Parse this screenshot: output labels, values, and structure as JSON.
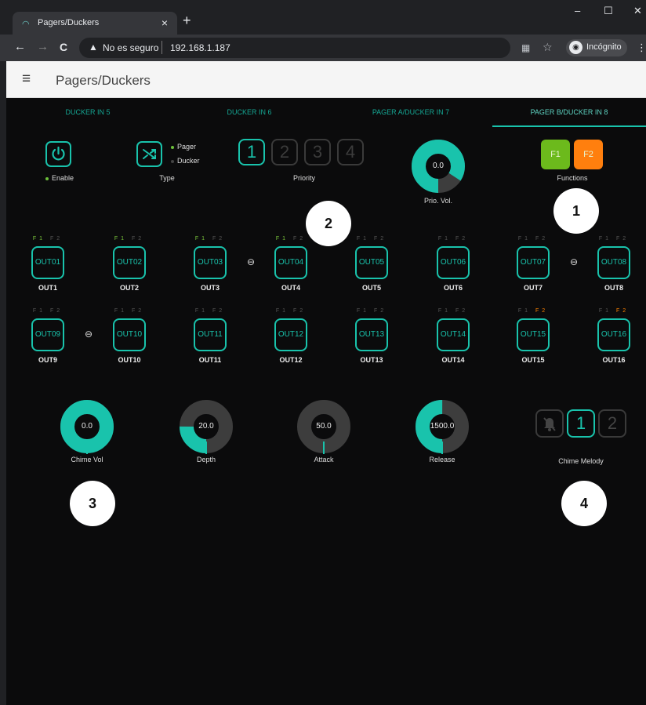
{
  "browser": {
    "tab_title": "Pagers/Duckers",
    "tab_close": "×",
    "new_tab": "+",
    "win_min": "–",
    "win_max": "☐",
    "win_close": "✕",
    "back": "←",
    "forward": "→",
    "reload": "C",
    "security_icon": "▲",
    "security_text": "No es seguro",
    "url": "192.168.1.187",
    "translate_icon": "▦",
    "star_icon": "☆",
    "incognito_label": "Incógnito",
    "menu_icon": "⋮"
  },
  "header": {
    "menu_icon": "≡",
    "title": "Pagers/Duckers"
  },
  "tabs": [
    {
      "label": "DUCKER IN 5"
    },
    {
      "label": "DUCKER IN 6"
    },
    {
      "label": "PAGER A/DUCKER IN 7"
    },
    {
      "label": "PAGER B/DUCKER IN 8"
    }
  ],
  "controls": {
    "enable_label": "Enable",
    "type_label": "Type",
    "type_options": [
      "Pager",
      "Ducker"
    ],
    "priority_label": "Priority",
    "priority_values": [
      "1",
      "2",
      "3",
      "4"
    ],
    "priority_selected": "1",
    "prio_vol_value": "0.0",
    "prio_vol_label": "Prio. Vol.",
    "prio_vol_fill": 0.84,
    "functions_label": "Functions",
    "f1": "F1",
    "f2": "F2",
    "f1_color": "#6cba1c",
    "f2_color": "#ff7f0e"
  },
  "flags": {
    "f1": "F1",
    "f2": "F2"
  },
  "outputs_row1": [
    {
      "btn": "OUT01",
      "label": "OUT1"
    },
    {
      "btn": "OUT02",
      "label": "OUT2"
    },
    {
      "btn": "OUT03",
      "label": "OUT3"
    },
    {
      "btn": "OUT04",
      "label": "OUT4"
    },
    {
      "btn": "OUT05",
      "label": "OUT5"
    },
    {
      "btn": "OUT06",
      "label": "OUT6"
    },
    {
      "btn": "OUT07",
      "label": "OUT7"
    },
    {
      "btn": "OUT08",
      "label": "OUT8"
    }
  ],
  "outputs_row2": [
    {
      "btn": "OUT09",
      "label": "OUT9"
    },
    {
      "btn": "OUT10",
      "label": "OUT10"
    },
    {
      "btn": "OUT11",
      "label": "OUT11"
    },
    {
      "btn": "OUT12",
      "label": "OUT12"
    },
    {
      "btn": "OUT13",
      "label": "OUT13"
    },
    {
      "btn": "OUT14",
      "label": "OUT14"
    },
    {
      "btn": "OUT15",
      "label": "OUT15"
    },
    {
      "btn": "OUT16",
      "label": "OUT16"
    }
  ],
  "knobs": [
    {
      "value": "0.0",
      "label": "Chime Vol",
      "fill": 1.0
    },
    {
      "value": "20.0",
      "label": "Depth",
      "fill": 0.25
    },
    {
      "value": "50.0",
      "label": "Attack",
      "fill": 0.0
    },
    {
      "value": "1500.0",
      "label": "Release",
      "fill": 0.5
    }
  ],
  "chime_melody": {
    "label": "Chime Melody",
    "options": [
      "1",
      "2"
    ],
    "selected": "1"
  },
  "callouts": [
    "1",
    "2",
    "3",
    "4"
  ],
  "accent": "#19c3ac"
}
